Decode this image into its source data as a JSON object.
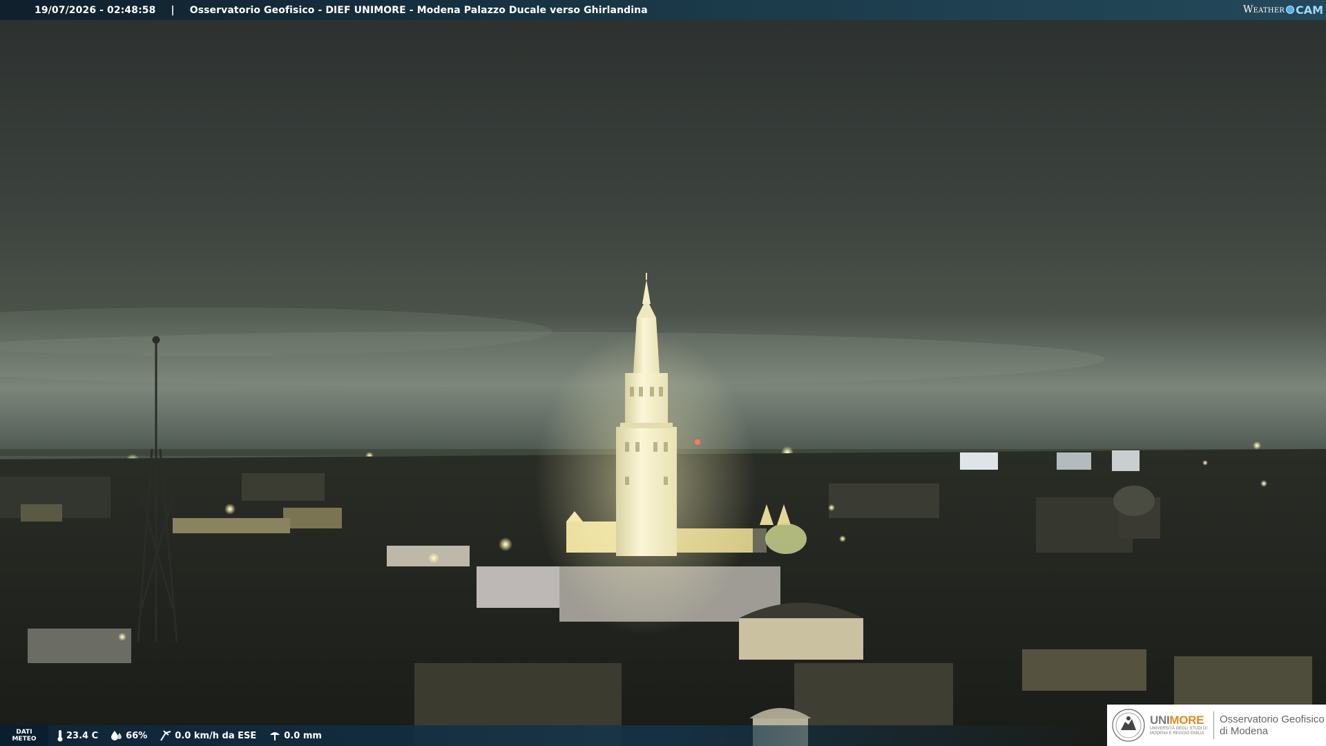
{
  "header": {
    "timestamp": "19/07/2026 - 02:48:58",
    "separator": "|",
    "title": "Osservatorio Geofisico - DIEF UNIMORE - Modena Palazzo Ducale verso Ghirlandina"
  },
  "brand": {
    "word": "Weather",
    "cam": "CAM"
  },
  "weather": {
    "section_label_line1": "DATI",
    "section_label_line2": "METEO",
    "temperature": "23.4 C",
    "humidity": "66%",
    "wind": "0.0 km/h da ESE",
    "rain": "0.0 mm"
  },
  "institution": {
    "uni_part1": "UNI",
    "uni_part2": "MORE",
    "uni_sub1": "UNIVERSITÀ DEGLI STUDI DI",
    "uni_sub2": "MODENA E REGGIO EMILIA",
    "observatory_line1": "Osservatorio Geofisico",
    "observatory_line2": "di Modena"
  },
  "colors": {
    "sky_top": "#2e3331",
    "sky_glow": "#6f7a70",
    "city_dark": "#1a1d1a",
    "tower_light": "#f6f0c8",
    "bar_blue": "#1b3a4a",
    "unimore_orange": "#e28a1e"
  },
  "icons": {
    "temperature": "thermometer-icon",
    "humidity": "droplet-icon",
    "wind": "wind-icon",
    "rain": "rain-gauge-icon"
  }
}
